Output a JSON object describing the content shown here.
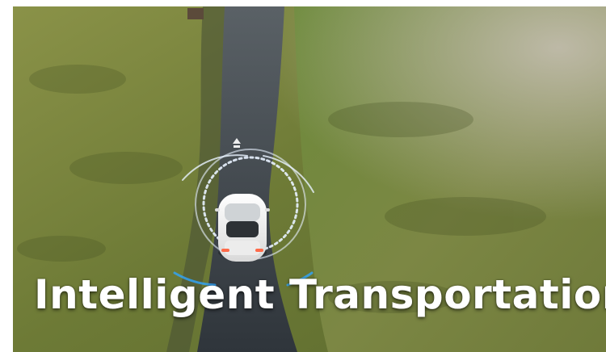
{
  "image": {
    "description_icon": "car-icon",
    "caption": "Intelligent Transportation",
    "colors": {
      "grass": "#6e7b3c",
      "road": "#3a4046",
      "car": "#f2f2f2",
      "sensor_ring": "#e8f2ff",
      "caption_text": "#ffffff"
    }
  }
}
